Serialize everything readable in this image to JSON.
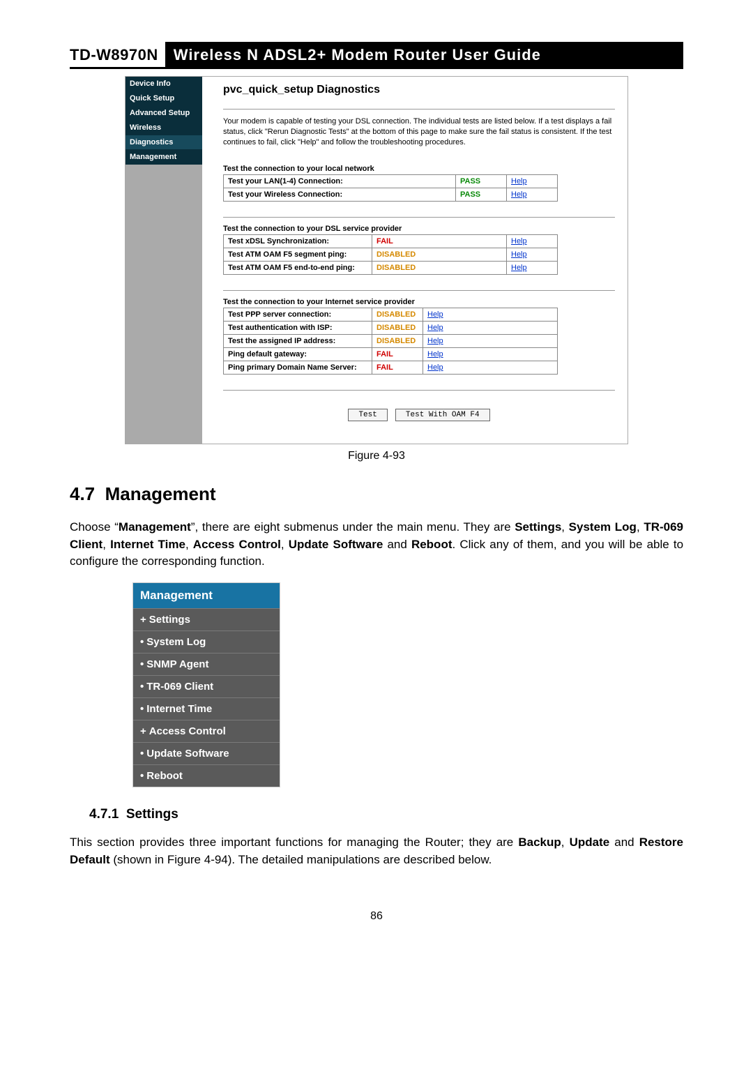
{
  "header": {
    "model": "TD-W8970N",
    "title": "Wireless N ADSL2+ Modem Router User Guide"
  },
  "sidebar": {
    "items": [
      "Device Info",
      "Quick Setup",
      "Advanced Setup",
      "Wireless",
      "Diagnostics",
      "Management"
    ],
    "selected_index": 4
  },
  "diag": {
    "title": "pvc_quick_setup Diagnostics",
    "intro": "Your modem is capable of testing your DSL connection. The individual tests are listed below. If a test displays a fail status, click \"Rerun Diagnostic Tests\" at the bottom of this page to make sure the fail status is consistent. If the test continues to fail, click \"Help\" and follow the troubleshooting procedures.",
    "help_label": "Help",
    "section1": {
      "heading": "Test the connection to your local network",
      "rows": [
        {
          "label": "Test your LAN(1-4) Connection:",
          "status": "PASS",
          "cls": "pass"
        },
        {
          "label": "Test your Wireless Connection:",
          "status": "PASS",
          "cls": "pass"
        }
      ]
    },
    "section2": {
      "heading": "Test the connection to your DSL service provider",
      "rows": [
        {
          "label": "Test xDSL Synchronization:",
          "status": "FAIL",
          "cls": "fail"
        },
        {
          "label": "Test ATM OAM F5 segment ping:",
          "status": "DISABLED",
          "cls": "disabled"
        },
        {
          "label": "Test ATM OAM F5 end-to-end ping:",
          "status": "DISABLED",
          "cls": "disabled"
        }
      ]
    },
    "section3": {
      "heading": "Test the connection to your Internet service provider",
      "rows": [
        {
          "label": "Test PPP server connection:",
          "status": "DISABLED",
          "cls": "disabled"
        },
        {
          "label": "Test authentication with ISP:",
          "status": "DISABLED",
          "cls": "disabled"
        },
        {
          "label": "Test the assigned IP address:",
          "status": "DISABLED",
          "cls": "disabled"
        },
        {
          "label": "Ping default gateway:",
          "status": "FAIL",
          "cls": "fail"
        },
        {
          "label": "Ping primary Domain Name Server:",
          "status": "FAIL",
          "cls": "fail"
        }
      ]
    },
    "buttons": {
      "test": "Test",
      "test_oam": "Test With OAM F4"
    }
  },
  "figure_caption": "Figure 4-93",
  "section47": {
    "num": "4.7",
    "title": "Management",
    "text_before": "Choose “",
    "bold": "Management",
    "text_mid": "”, there are eight submenus under the main menu. They are ",
    "list": [
      {
        "t": "Settings",
        "sep": ", "
      },
      {
        "t": "System Log",
        "sep": ", "
      },
      {
        "t": "TR-069 Client",
        "sep": ", "
      },
      {
        "t": "Internet Time",
        "sep": ", "
      },
      {
        "t": "Access Control",
        "sep": ", "
      },
      {
        "t": "Update Software",
        "sep": " and "
      },
      {
        "t": "Reboot",
        "sep": ". "
      }
    ],
    "text_after": "Click any of them, and you will be able to configure the corresponding function."
  },
  "mgmt_menu": {
    "header": "Management",
    "items": [
      {
        "bullet": "+",
        "label": "Settings"
      },
      {
        "bullet": "•",
        "label": "System Log"
      },
      {
        "bullet": "•",
        "label": "SNMP Agent"
      },
      {
        "bullet": "•",
        "label": "TR-069 Client"
      },
      {
        "bullet": "•",
        "label": "Internet Time"
      },
      {
        "bullet": "+",
        "label": "Access Control"
      },
      {
        "bullet": "•",
        "label": "Update Software"
      },
      {
        "bullet": "•",
        "label": "Reboot"
      }
    ]
  },
  "section471": {
    "num": "4.7.1",
    "title": "Settings",
    "p_before": "This section provides three important functions for managing the Router; they are ",
    "backup": "Backup",
    "sep1": ", ",
    "update": "Update",
    "sep2": " and ",
    "restore": "Restore Default",
    "p_after": " (shown in Figure 4-94). The detailed manipulations are described below."
  },
  "page_number": "86"
}
